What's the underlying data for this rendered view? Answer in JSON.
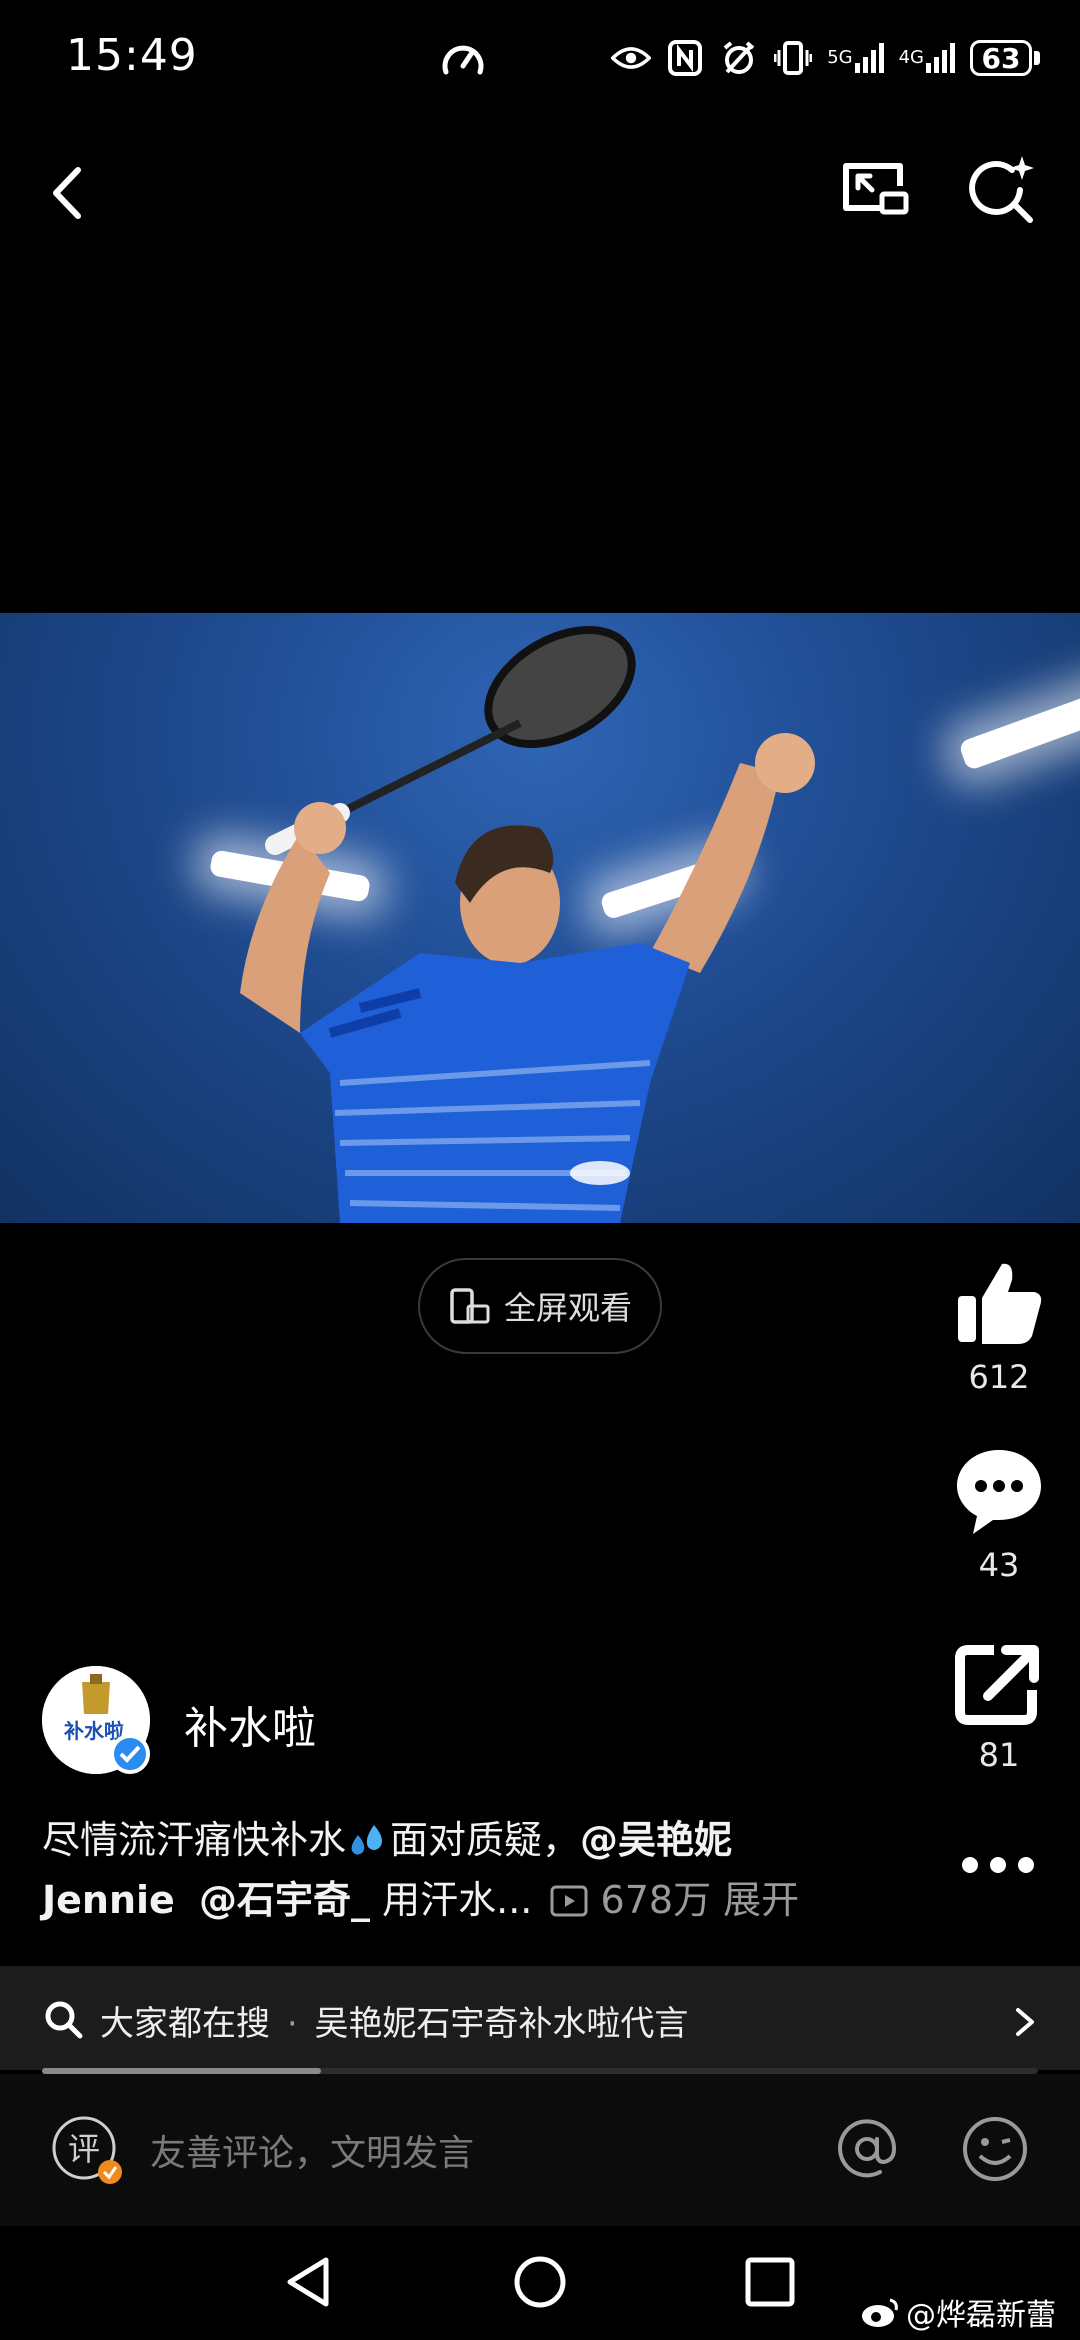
{
  "status_bar": {
    "time": "15:49",
    "signal_5g": "5G",
    "signal_4g": "4G",
    "battery": "63"
  },
  "video": {
    "fullscreen_label": "全屏观看"
  },
  "actions": {
    "likes": "612",
    "comments": "43",
    "shares": "81"
  },
  "author": {
    "name": "补水啦",
    "avatar_text": "补水啦"
  },
  "caption": {
    "text1": "尽情流汗痛快补水",
    "text2": "面对质疑，",
    "mention1": "@吴艳妮",
    "line2_start": "Jennie",
    "mention2": "@石宇奇_",
    "text3": "用汗水...",
    "views": "678万",
    "expand": "展开"
  },
  "search": {
    "prefix": "大家都在搜",
    "separator": "·",
    "query": "吴艳妮石宇奇补水啦代言",
    "progress": 0.28
  },
  "comment": {
    "placeholder": "友善评论，文明发言",
    "badge": "评"
  },
  "watermark": "@烨磊新蕾"
}
